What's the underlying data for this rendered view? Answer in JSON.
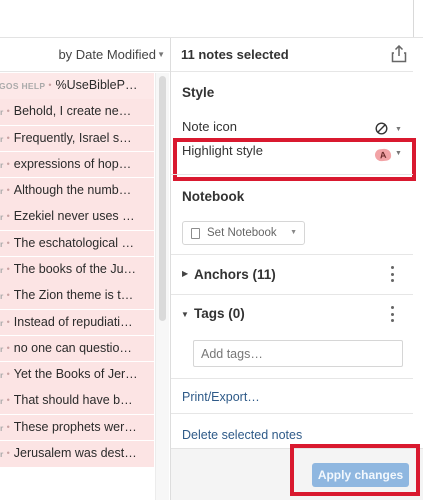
{
  "notes_list": {
    "sort_label": "by Date Modified",
    "rows": [
      {
        "tag": "GOS HELP",
        "text": "%UseBibleP…"
      },
      {
        "tag": "",
        "text": "Behold, I create ne…"
      },
      {
        "tag": "",
        "text": "Frequently, Israel s…"
      },
      {
        "tag": "",
        "text": "expressions of hop…"
      },
      {
        "tag": "",
        "text": "Although the numb…"
      },
      {
        "tag": "",
        "text": "Ezekiel never uses …"
      },
      {
        "tag": "",
        "text": "The eschatological …"
      },
      {
        "tag": "",
        "text": "The books of the Ju…"
      },
      {
        "tag": "",
        "text": "The Zion theme is t…"
      },
      {
        "tag": "",
        "text": "Instead of repudiati…"
      },
      {
        "tag": "",
        "text": "no one can questio…"
      },
      {
        "tag": "",
        "text": "Yet the Books of Jer…"
      },
      {
        "tag": "",
        "text": "That should have b…"
      },
      {
        "tag": "",
        "text": "These prophets wer…"
      },
      {
        "tag": "",
        "text": "Jerusalem was dest…"
      }
    ],
    "row_bullet": "r"
  },
  "panel": {
    "selected_count": "11 notes selected",
    "style_title": "Style",
    "note_icon_label": "Note icon",
    "highlight_style_label": "Highlight style",
    "highlight_sample_letter": "A",
    "notebook_title": "Notebook",
    "set_notebook_label": "Set Notebook",
    "anchors_label": "Anchors (11)",
    "tags_label": "Tags (0)",
    "tags_placeholder": "Add tags…",
    "print_export_label": "Print/Export…",
    "delete_label": "Delete selected notes",
    "apply_label": "Apply changes"
  },
  "colors": {
    "row_background": "#fce4e4",
    "link": "#2e5a88",
    "annotation_box": "#d9192f",
    "apply_button": "#8fb7e0"
  },
  "icons": {
    "share": "share-icon",
    "note_icon_none": "no-symbol-icon",
    "dropdown": "chevron-down-icon",
    "notebook": "notebook-icon",
    "more": "kebab-icon"
  }
}
